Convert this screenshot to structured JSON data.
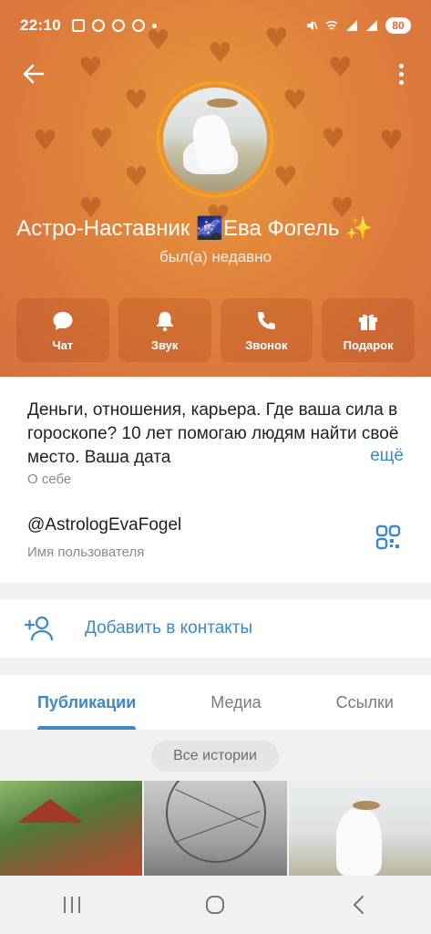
{
  "status_bar": {
    "time": "22:10",
    "battery": "80"
  },
  "profile": {
    "name": "Астро-Наставник 🌌Ева Фогель ✨",
    "status": "был(а) недавно"
  },
  "actions": [
    {
      "label": "Чат",
      "icon": "chat-icon"
    },
    {
      "label": "Звук",
      "icon": "bell-icon"
    },
    {
      "label": "Звонок",
      "icon": "phone-icon"
    },
    {
      "label": "Подарок",
      "icon": "gift-icon"
    }
  ],
  "info": {
    "bio": "Деньги, отношения, карьера. Где ваша сила в гороскопе? 10 лет помогаю людям найти своё место. Ваша дата",
    "bio_more": "ещё",
    "bio_label": "О себе",
    "username": "@AstrologEvaFogel",
    "username_label": "Имя пользователя"
  },
  "add_contact": {
    "label": "Добавить в контакты"
  },
  "tabs": [
    {
      "label": "Публикации",
      "active": true
    },
    {
      "label": "Медиа",
      "active": false
    },
    {
      "label": "Ссылки",
      "active": false
    }
  ],
  "stories": {
    "label": "Все истории"
  },
  "colors": {
    "accent": "#3e88c8",
    "header": "#e0823c",
    "ring": "#f5a21f"
  }
}
